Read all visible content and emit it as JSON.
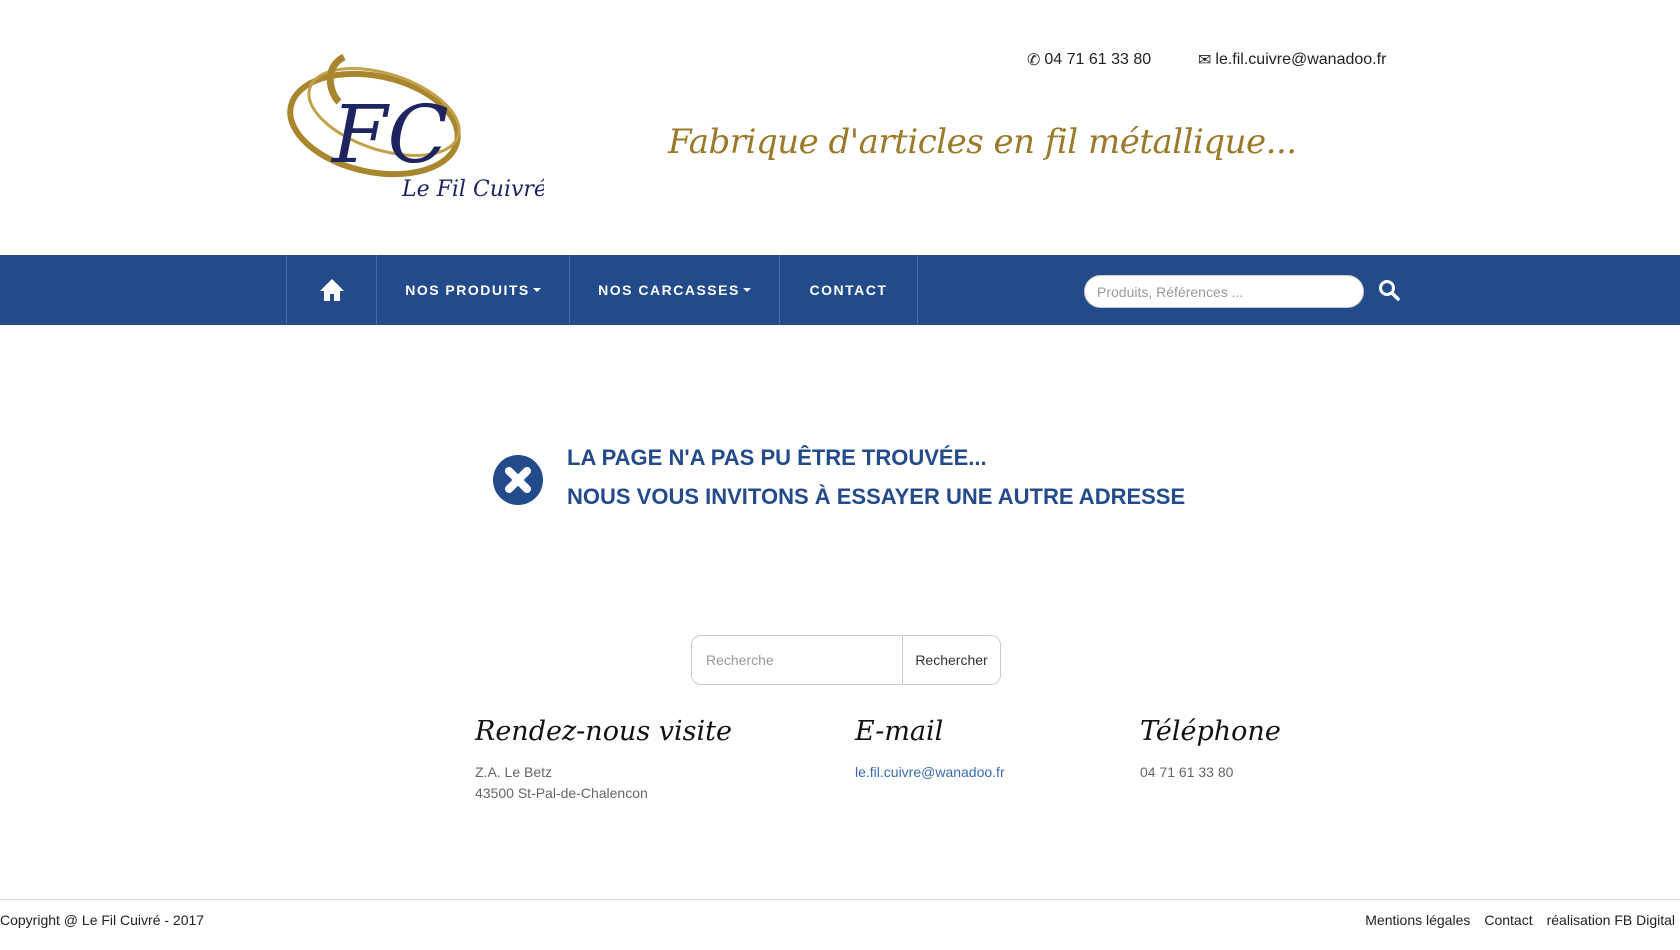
{
  "header": {
    "logo_text": "Le Fil Cuivré",
    "logo_monogram": "FC",
    "phone": "04 71 61 33 80",
    "email": "le.fil.cuivre@wanadoo.fr",
    "tagline": "Fabrique d'articles en fil métallique..."
  },
  "nav": {
    "items": [
      {
        "label": "NOS PRODUITS"
      },
      {
        "label": "NOS CARCASSES"
      },
      {
        "label": "CONTACT"
      }
    ],
    "search_placeholder": "Produits, Références ..."
  },
  "error": {
    "line1": "LA PAGE N'A PAS PU ÊTRE TROUVÉE...",
    "line2": "NOUS VOUS INVITONS À ESSAYER UNE AUTRE ADRESSE"
  },
  "search": {
    "placeholder": "Recherche",
    "button": "Rechercher"
  },
  "footer": {
    "visit_title": "Rendez-nous visite",
    "address1": "Z.A. Le Betz",
    "address2": "43500 St-Pal-de-Chalencon",
    "email_title": "E-mail",
    "email": "le.fil.cuivre@wanadoo.fr",
    "phone_title": "Téléphone",
    "phone": "04 71 61 33 80",
    "copyright": "Copyright @ Le Fil Cuivré - 2017",
    "links": [
      "Mentions légales",
      "Contact",
      "réalisation FB Digital"
    ]
  },
  "colors": {
    "brand": "#234b8c",
    "gold": "#9a7a2a"
  }
}
